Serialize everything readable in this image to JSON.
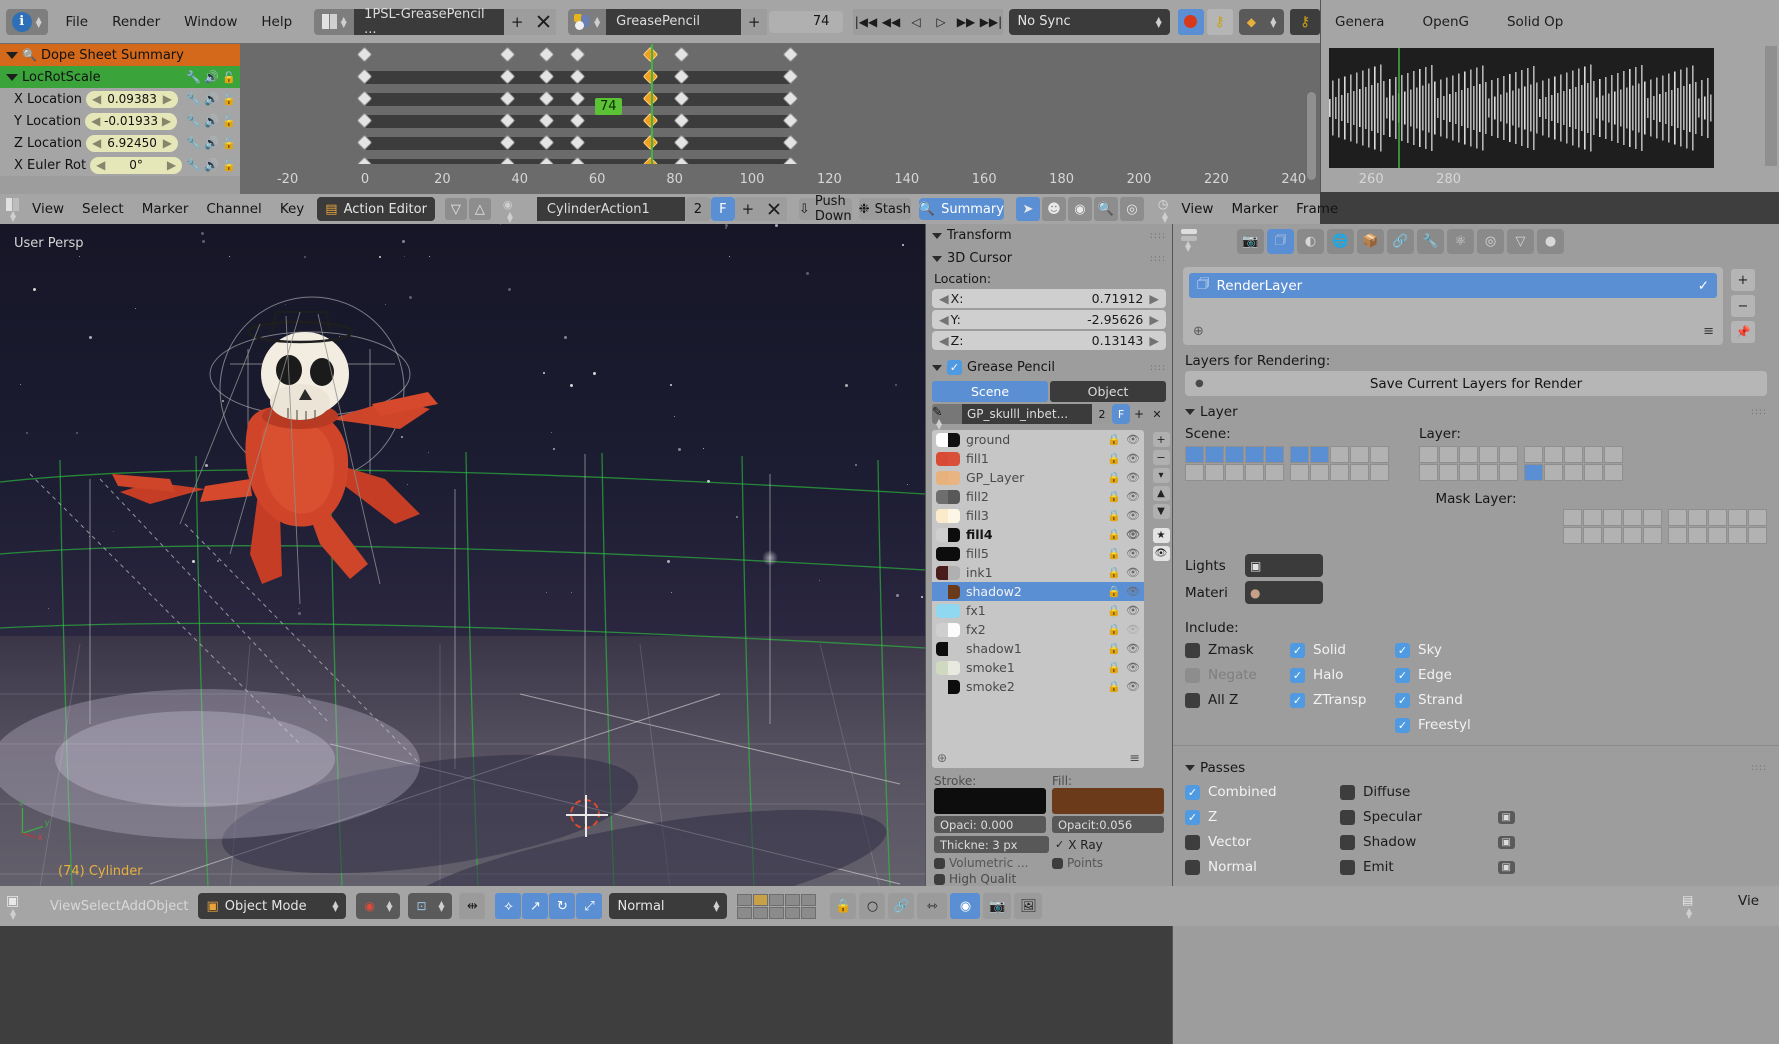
{
  "topbar": {
    "menus": [
      "File",
      "Render",
      "Window",
      "Help"
    ],
    "screen_layout": "1PSL-GreasePencil ...",
    "scene_name": "GreasePencil",
    "frame_current": "74",
    "sync_mode": "No Sync",
    "add_icon": "+",
    "close_icon": "x",
    "playback": [
      "jump-start",
      "prev-keyframe",
      "play-reverse",
      "play",
      "next-keyframe",
      "jump-end"
    ]
  },
  "right_window": {
    "tabs": [
      "Genera",
      "OpenG",
      "Solid Op"
    ]
  },
  "dopesheet": {
    "channels": [
      {
        "label": "Dope Sheet Summary",
        "type": "summary",
        "value": null
      },
      {
        "label": "LocRotScale",
        "type": "group",
        "value": null
      },
      {
        "label": "X Location",
        "type": "fcurve",
        "value": "0.09383"
      },
      {
        "label": "Y Location",
        "type": "fcurve",
        "value": "-0.01933"
      },
      {
        "label": "Z Location",
        "type": "fcurve",
        "value": "6.92450"
      },
      {
        "label": "X Euler Rot",
        "type": "fcurve",
        "value": "0°"
      }
    ],
    "ruler_ticks": [
      "-20",
      "0",
      "20",
      "40",
      "60",
      "80",
      "100",
      "120",
      "140",
      "160",
      "180",
      "200",
      "220",
      "240",
      "260",
      "280"
    ],
    "playhead_frame": "74",
    "keyframe_frames": [
      0,
      37,
      47,
      55,
      74,
      82,
      110
    ],
    "colors": {
      "summary": "#d4691b",
      "group": "#3aa33a",
      "playhead": "#3fb73f",
      "playhead_flag_bg": "#5bc236"
    }
  },
  "action_editor": {
    "menus": [
      "View",
      "Select",
      "Marker",
      "Channel",
      "Key"
    ],
    "mode": "Action Editor",
    "action_name": "CylinderAction1",
    "users": "2",
    "fake_user": "F",
    "push_down": "Push Down",
    "stash": "Stash",
    "summary": "Summary",
    "add_icon": "+",
    "close_icon": "x"
  },
  "viewport": {
    "view_name": "User Persp",
    "active_object": "(74) Cylinder",
    "axis_labels": [
      "z",
      "y",
      "x"
    ]
  },
  "gp_panel": {
    "transform_title": "Transform",
    "cursor_title": "3D Cursor",
    "location_label": "Location:",
    "cursor": [
      {
        "axis": "X:",
        "value": "0.71912"
      },
      {
        "axis": "Y:",
        "value": "-2.95626"
      },
      {
        "axis": "Z:",
        "value": "0.13143"
      }
    ],
    "gp_title": "Grease Pencil",
    "tabs": {
      "scene": "Scene",
      "object": "Object"
    },
    "datablock": "GP_skulll_inbet...",
    "datablock_users": "2",
    "datablock_fake": "F",
    "layers": [
      {
        "name": "ground",
        "c1": "#ffffff",
        "c2": "#101010",
        "selected": false,
        "bold": false,
        "hidden": false
      },
      {
        "name": "fill1",
        "c1": "#d94a35",
        "c2": "#d9503a",
        "selected": false,
        "bold": false,
        "hidden": false
      },
      {
        "name": "GP_Layer",
        "c1": "#e8b07a",
        "c2": "#e9b481",
        "selected": false,
        "bold": false,
        "hidden": false
      },
      {
        "name": "fill2",
        "c1": "#6e6e6e",
        "c2": "#585858",
        "selected": false,
        "bold": false,
        "hidden": false
      },
      {
        "name": "fill3",
        "c1": "#faeccb",
        "c2": "#fdf6e6",
        "selected": false,
        "bold": false,
        "hidden": false
      },
      {
        "name": "fill4",
        "c1": "#cfcfcf",
        "c2": "#0d0d0d",
        "selected": false,
        "bold": true,
        "hidden": false
      },
      {
        "name": "fill5",
        "c1": "#0d0d0d",
        "c2": "#0d0d0d",
        "selected": false,
        "bold": false,
        "hidden": false
      },
      {
        "name": "ink1",
        "c1": "#4a1d1d",
        "c2": "#b0b0b0",
        "selected": false,
        "bold": false,
        "hidden": false
      },
      {
        "name": "shadow2",
        "c1": "#5b8fd4",
        "c2": "#6b3a1b",
        "selected": true,
        "bold": false,
        "hidden": false
      },
      {
        "name": "fx1",
        "c1": "#8fd8ef",
        "c2": "#8fd8ef",
        "selected": false,
        "bold": false,
        "hidden": false
      },
      {
        "name": "fx2",
        "c1": "#cfcfcf",
        "c2": "#fcfcfc",
        "selected": false,
        "bold": false,
        "hidden": true
      },
      {
        "name": "shadow1",
        "c1": "#0d0d0d",
        "c2": "#c6c6c6",
        "selected": false,
        "bold": false,
        "hidden": false
      },
      {
        "name": "smoke1",
        "c1": "#cfd8c0",
        "c2": "#e8eadf",
        "selected": false,
        "bold": false,
        "hidden": false
      },
      {
        "name": "smoke2",
        "c1": "#c6c6c6",
        "c2": "#0d0d0d",
        "selected": false,
        "bold": false,
        "hidden": false
      }
    ],
    "stroke_label": "Stroke:",
    "fill_label": "Fill:",
    "stroke_color": "#0d0d0d",
    "fill_color": "#6b3a1b",
    "stroke_opacity": "Opaci: 0.000",
    "fill_opacity": "Opacit:0.056",
    "thickness": "Thickne: 3 px",
    "xray": "X Ray",
    "volumetric": "Volumetric ...",
    "points": "Points",
    "high_quality": "High Qualit"
  },
  "render_props": {
    "renderlayer_name": "RenderLayer",
    "layers_for_rendering": "Layers for Rendering:",
    "save_current": "Save Current Layers for Render",
    "layer_title": "Layer",
    "scene_label": "Scene:",
    "layer_label": "Layer:",
    "mask_layer_label": "Mask Layer:",
    "lights_label": "Lights",
    "material_label": "Materi",
    "include_label": "Include:",
    "include": [
      {
        "label": "Zmask",
        "state": "off"
      },
      {
        "label": "Negate",
        "state": "disabled"
      },
      {
        "label": "All Z",
        "state": "off"
      },
      {
        "label": "Solid",
        "state": "on"
      },
      {
        "label": "Halo",
        "state": "on"
      },
      {
        "label": "ZTransp",
        "state": "on"
      },
      {
        "label": "Sky",
        "state": "on"
      },
      {
        "label": "Edge",
        "state": "on"
      },
      {
        "label": "Strand",
        "state": "on"
      },
      {
        "label": "Freestyl",
        "state": "on"
      }
    ],
    "passes_title": "Passes",
    "passes": [
      {
        "label": "Combined",
        "state": "on",
        "extra": false
      },
      {
        "label": "Z",
        "state": "on",
        "extra": false
      },
      {
        "label": "Vector",
        "state": "off",
        "extra": false
      },
      {
        "label": "Normal",
        "state": "off",
        "extra": false
      },
      {
        "label": "Diffuse",
        "state": "off",
        "extra": false
      },
      {
        "label": "Specular",
        "state": "off",
        "extra": true
      },
      {
        "label": "Shadow",
        "state": "off",
        "extra": true
      },
      {
        "label": "Emit",
        "state": "off",
        "extra": true
      }
    ]
  },
  "view3d_header": {
    "menus": [
      "View",
      "Select",
      "Add",
      "Object"
    ],
    "mode": "Object Mode",
    "orientation": "Normal"
  },
  "right_footer": {
    "menus": [
      "View",
      "Marker",
      "Frame"
    ],
    "tail": "Vie"
  }
}
